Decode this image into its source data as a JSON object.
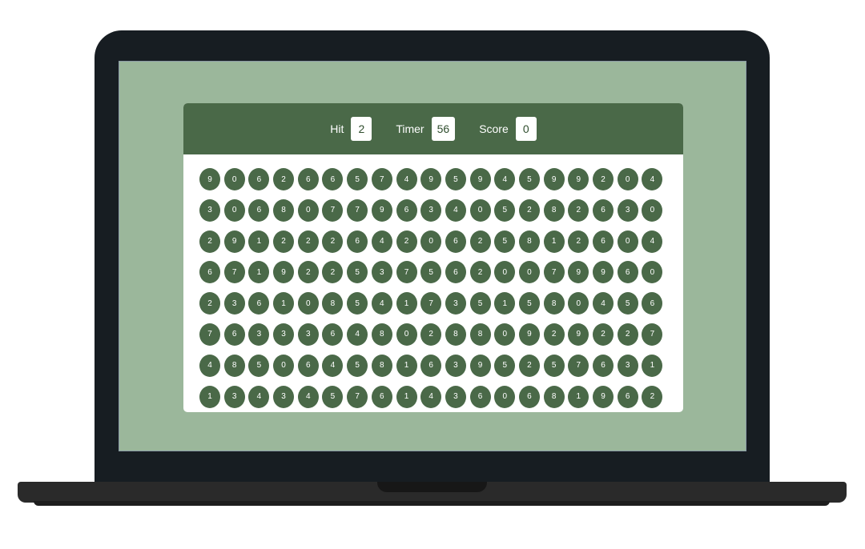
{
  "hud": {
    "hit_label": "Hit",
    "hit_value": "2",
    "timer_label": "Timer",
    "timer_value": "56",
    "score_label": "Score",
    "score_value": "0"
  },
  "colors": {
    "page_background": "#9bb79b",
    "accent_green": "#4a6948",
    "laptop_frame": "#171d22",
    "panel_white": "#ffffff"
  },
  "grid": {
    "rows": [
      [
        "9",
        "0",
        "6",
        "2",
        "6",
        "6",
        "5",
        "7",
        "4",
        "9",
        "5",
        "9",
        "4",
        "5",
        "9",
        "9",
        "2",
        "0",
        "4"
      ],
      [
        "3",
        "0",
        "6",
        "8",
        "0",
        "7",
        "7",
        "9",
        "6",
        "3",
        "4",
        "0",
        "5",
        "2",
        "8",
        "2",
        "6",
        "3",
        "0"
      ],
      [
        "2",
        "9",
        "1",
        "2",
        "2",
        "2",
        "6",
        "4",
        "2",
        "0",
        "6",
        "2",
        "5",
        "8",
        "1",
        "2",
        "6",
        "0",
        "4"
      ],
      [
        "6",
        "7",
        "1",
        "9",
        "2",
        "2",
        "5",
        "3",
        "7",
        "5",
        "6",
        "2",
        "0",
        "0",
        "7",
        "9",
        "9",
        "6",
        "0"
      ],
      [
        "2",
        "3",
        "6",
        "1",
        "0",
        "8",
        "5",
        "4",
        "1",
        "7",
        "3",
        "5",
        "1",
        "5",
        "8",
        "0",
        "4",
        "5",
        "6"
      ],
      [
        "7",
        "6",
        "3",
        "3",
        "3",
        "6",
        "4",
        "8",
        "0",
        "2",
        "8",
        "8",
        "0",
        "9",
        "2",
        "9",
        "2",
        "2",
        "7"
      ],
      [
        "4",
        "8",
        "5",
        "0",
        "6",
        "4",
        "5",
        "8",
        "1",
        "6",
        "3",
        "9",
        "5",
        "2",
        "5",
        "7",
        "6",
        "3",
        "1"
      ],
      [
        "1",
        "3",
        "4",
        "3",
        "4",
        "5",
        "7",
        "6",
        "1",
        "4",
        "3",
        "6",
        "0",
        "6",
        "8",
        "1",
        "9",
        "6",
        "2"
      ]
    ]
  }
}
